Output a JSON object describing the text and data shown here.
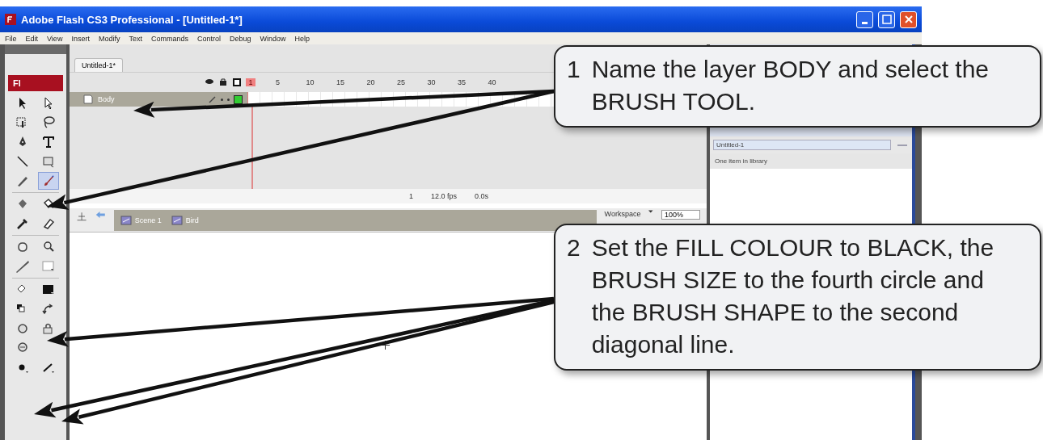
{
  "window": {
    "title": "Adobe Flash CS3 Professional - [Untitled-1*]"
  },
  "menu": [
    "File",
    "Edit",
    "View",
    "Insert",
    "Modify",
    "Text",
    "Commands",
    "Control",
    "Debug",
    "Window",
    "Help"
  ],
  "logo": "Fl",
  "tools": [
    {
      "selected": false
    },
    {
      "selected": false
    },
    {
      "selected": false
    },
    {
      "selected": false
    },
    {
      "selected": false
    },
    {
      "selected": false
    },
    {
      "selected": false
    },
    {
      "selected": false
    },
    {
      "selected": false
    },
    {
      "selected": true
    },
    {
      "selected": false
    },
    {
      "selected": false
    },
    {
      "selected": false
    },
    {
      "selected": false
    },
    {
      "selected": false
    },
    {
      "selected": false
    },
    {
      "selected": false
    },
    {
      "selected": false
    },
    {
      "selected": false
    },
    {
      "selected": false
    },
    {
      "selected": false
    },
    {
      "selected": false
    },
    {
      "selected": false
    },
    {
      "selected": false
    },
    {
      "selected": false
    },
    {
      "selected": false
    },
    {
      "selected": false
    }
  ],
  "document_tab": {
    "label": "Untitled-1*"
  },
  "timeline": {
    "frame_numbers": [
      "1",
      "5",
      "10",
      "15",
      "20",
      "25",
      "30",
      "35",
      "40"
    ],
    "layers": [
      {
        "name": "Body",
        "selected": true
      }
    ],
    "status": [
      "1",
      "12.0 fps",
      "0.0s"
    ]
  },
  "edit_bar": {
    "crumbs": [
      "Scene 1",
      "Bird"
    ],
    "workspace": "Workspace",
    "zoom": "100%"
  },
  "library": {
    "document": "Untitled-1",
    "count": "One item in library"
  },
  "callouts": [
    {
      "number": "1",
      "text": "Name the layer BODY and select the BRUSH TOOL."
    },
    {
      "number": "2",
      "text": "Set the FILL COLOUR to BLACK, the BRUSH SIZE to the fourth circle and the BRUSH SHAPE to the second diagonal line."
    }
  ]
}
